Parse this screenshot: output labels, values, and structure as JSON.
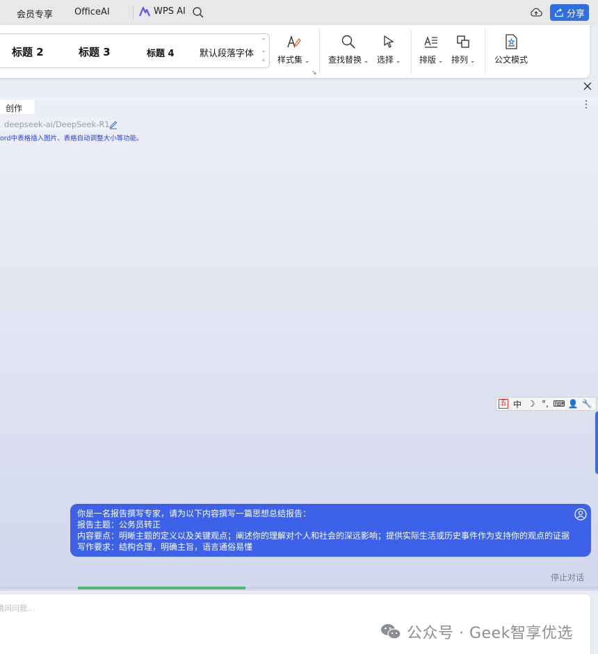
{
  "topbar": {
    "menu_member": "会员专享",
    "menu_officeai": "OfficeAI",
    "wps_ai": "WPS AI",
    "share": "分享"
  },
  "ribbon": {
    "styles": [
      "标题 2",
      "标题 3",
      "标题 4",
      "默认段落字体"
    ],
    "style_set": "样式集",
    "find_replace": "查找替换",
    "select": "选择",
    "layout": "排版",
    "arrange": "排列",
    "official_mode": "公文模式"
  },
  "panel": {
    "tab_create": "创作",
    "model": "deepseek-ai/DeepSeek-R1",
    "hint": "ord中表格插入图片、表格自动调整大小等功能。"
  },
  "ime": {
    "items": [
      "五",
      "中",
      "☽",
      "°,",
      "⌨",
      "👤",
      "🔧"
    ]
  },
  "message": {
    "lines": [
      "你是一名报告撰写专家，请为以下内容撰写一篇思想总结报告：",
      "报告主题：公务员转正",
      "内容要点：明晰主题的定义以及关键观点；阐述你的理解对个人和社会的深远影响；提供实际生活或历史事件作为支持你的观点的证据",
      "写作要求：结构合理，明确主旨，语言通俗易懂"
    ]
  },
  "stop_label": "停止对话",
  "progress_fraction": 0.28,
  "input": {
    "placeholder": "请问问我…"
  },
  "watermark": "公众号 · Geek智享优选",
  "colors": {
    "accent": "#3d62e8",
    "share": "#2f6fe0",
    "progress": "#4cbb7a"
  }
}
